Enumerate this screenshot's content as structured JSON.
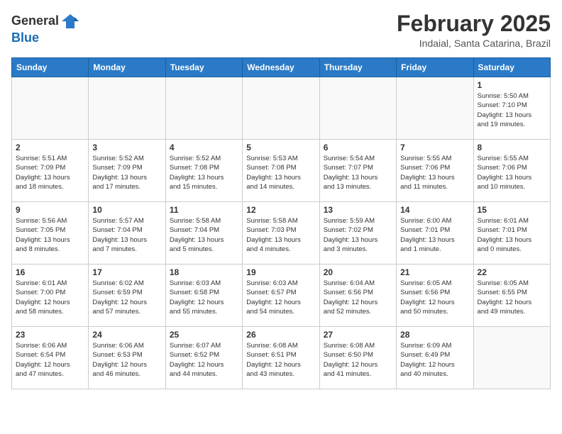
{
  "header": {
    "logo_line1": "General",
    "logo_line2": "Blue",
    "month_title": "February 2025",
    "location": "Indaial, Santa Catarina, Brazil"
  },
  "weekdays": [
    "Sunday",
    "Monday",
    "Tuesday",
    "Wednesday",
    "Thursday",
    "Friday",
    "Saturday"
  ],
  "weeks": [
    [
      {
        "day": "",
        "info": ""
      },
      {
        "day": "",
        "info": ""
      },
      {
        "day": "",
        "info": ""
      },
      {
        "day": "",
        "info": ""
      },
      {
        "day": "",
        "info": ""
      },
      {
        "day": "",
        "info": ""
      },
      {
        "day": "1",
        "info": "Sunrise: 5:50 AM\nSunset: 7:10 PM\nDaylight: 13 hours\nand 19 minutes."
      }
    ],
    [
      {
        "day": "2",
        "info": "Sunrise: 5:51 AM\nSunset: 7:09 PM\nDaylight: 13 hours\nand 18 minutes."
      },
      {
        "day": "3",
        "info": "Sunrise: 5:52 AM\nSunset: 7:09 PM\nDaylight: 13 hours\nand 17 minutes."
      },
      {
        "day": "4",
        "info": "Sunrise: 5:52 AM\nSunset: 7:08 PM\nDaylight: 13 hours\nand 15 minutes."
      },
      {
        "day": "5",
        "info": "Sunrise: 5:53 AM\nSunset: 7:08 PM\nDaylight: 13 hours\nand 14 minutes."
      },
      {
        "day": "6",
        "info": "Sunrise: 5:54 AM\nSunset: 7:07 PM\nDaylight: 13 hours\nand 13 minutes."
      },
      {
        "day": "7",
        "info": "Sunrise: 5:55 AM\nSunset: 7:06 PM\nDaylight: 13 hours\nand 11 minutes."
      },
      {
        "day": "8",
        "info": "Sunrise: 5:55 AM\nSunset: 7:06 PM\nDaylight: 13 hours\nand 10 minutes."
      }
    ],
    [
      {
        "day": "9",
        "info": "Sunrise: 5:56 AM\nSunset: 7:05 PM\nDaylight: 13 hours\nand 8 minutes."
      },
      {
        "day": "10",
        "info": "Sunrise: 5:57 AM\nSunset: 7:04 PM\nDaylight: 13 hours\nand 7 minutes."
      },
      {
        "day": "11",
        "info": "Sunrise: 5:58 AM\nSunset: 7:04 PM\nDaylight: 13 hours\nand 5 minutes."
      },
      {
        "day": "12",
        "info": "Sunrise: 5:58 AM\nSunset: 7:03 PM\nDaylight: 13 hours\nand 4 minutes."
      },
      {
        "day": "13",
        "info": "Sunrise: 5:59 AM\nSunset: 7:02 PM\nDaylight: 13 hours\nand 3 minutes."
      },
      {
        "day": "14",
        "info": "Sunrise: 6:00 AM\nSunset: 7:01 PM\nDaylight: 13 hours\nand 1 minute."
      },
      {
        "day": "15",
        "info": "Sunrise: 6:01 AM\nSunset: 7:01 PM\nDaylight: 13 hours\nand 0 minutes."
      }
    ],
    [
      {
        "day": "16",
        "info": "Sunrise: 6:01 AM\nSunset: 7:00 PM\nDaylight: 12 hours\nand 58 minutes."
      },
      {
        "day": "17",
        "info": "Sunrise: 6:02 AM\nSunset: 6:59 PM\nDaylight: 12 hours\nand 57 minutes."
      },
      {
        "day": "18",
        "info": "Sunrise: 6:03 AM\nSunset: 6:58 PM\nDaylight: 12 hours\nand 55 minutes."
      },
      {
        "day": "19",
        "info": "Sunrise: 6:03 AM\nSunset: 6:57 PM\nDaylight: 12 hours\nand 54 minutes."
      },
      {
        "day": "20",
        "info": "Sunrise: 6:04 AM\nSunset: 6:56 PM\nDaylight: 12 hours\nand 52 minutes."
      },
      {
        "day": "21",
        "info": "Sunrise: 6:05 AM\nSunset: 6:56 PM\nDaylight: 12 hours\nand 50 minutes."
      },
      {
        "day": "22",
        "info": "Sunrise: 6:05 AM\nSunset: 6:55 PM\nDaylight: 12 hours\nand 49 minutes."
      }
    ],
    [
      {
        "day": "23",
        "info": "Sunrise: 6:06 AM\nSunset: 6:54 PM\nDaylight: 12 hours\nand 47 minutes."
      },
      {
        "day": "24",
        "info": "Sunrise: 6:06 AM\nSunset: 6:53 PM\nDaylight: 12 hours\nand 46 minutes."
      },
      {
        "day": "25",
        "info": "Sunrise: 6:07 AM\nSunset: 6:52 PM\nDaylight: 12 hours\nand 44 minutes."
      },
      {
        "day": "26",
        "info": "Sunrise: 6:08 AM\nSunset: 6:51 PM\nDaylight: 12 hours\nand 43 minutes."
      },
      {
        "day": "27",
        "info": "Sunrise: 6:08 AM\nSunset: 6:50 PM\nDaylight: 12 hours\nand 41 minutes."
      },
      {
        "day": "28",
        "info": "Sunrise: 6:09 AM\nSunset: 6:49 PM\nDaylight: 12 hours\nand 40 minutes."
      },
      {
        "day": "",
        "info": ""
      }
    ]
  ]
}
